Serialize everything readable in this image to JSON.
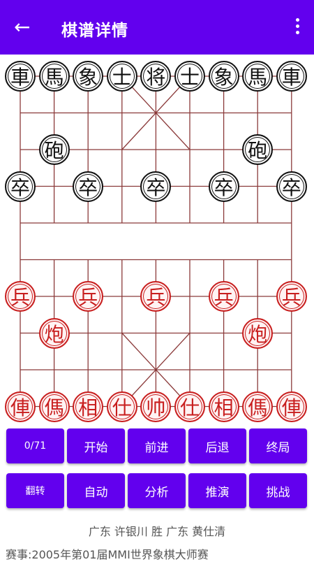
{
  "header": {
    "back_icon": "arrow-left-icon",
    "title": "棋谱详情",
    "more_icon": "more-vert-icon"
  },
  "colors": {
    "primary": "#6200ee",
    "board_line": "#8b3a3a",
    "red_piece": "#c81e1e",
    "black_piece": "#111111"
  },
  "board": {
    "black_pieces": [
      {
        "char": "車",
        "file": 0,
        "rank": 0
      },
      {
        "char": "馬",
        "file": 1,
        "rank": 0
      },
      {
        "char": "象",
        "file": 2,
        "rank": 0
      },
      {
        "char": "士",
        "file": 3,
        "rank": 0
      },
      {
        "char": "将",
        "file": 4,
        "rank": 0
      },
      {
        "char": "士",
        "file": 5,
        "rank": 0
      },
      {
        "char": "象",
        "file": 6,
        "rank": 0
      },
      {
        "char": "馬",
        "file": 7,
        "rank": 0
      },
      {
        "char": "車",
        "file": 8,
        "rank": 0
      },
      {
        "char": "砲",
        "file": 1,
        "rank": 2
      },
      {
        "char": "砲",
        "file": 7,
        "rank": 2
      },
      {
        "char": "卒",
        "file": 0,
        "rank": 3
      },
      {
        "char": "卒",
        "file": 2,
        "rank": 3
      },
      {
        "char": "卒",
        "file": 4,
        "rank": 3
      },
      {
        "char": "卒",
        "file": 6,
        "rank": 3
      },
      {
        "char": "卒",
        "file": 8,
        "rank": 3
      }
    ],
    "red_pieces": [
      {
        "char": "兵",
        "file": 0,
        "rank": 6
      },
      {
        "char": "兵",
        "file": 2,
        "rank": 6
      },
      {
        "char": "兵",
        "file": 4,
        "rank": 6
      },
      {
        "char": "兵",
        "file": 6,
        "rank": 6
      },
      {
        "char": "兵",
        "file": 8,
        "rank": 6
      },
      {
        "char": "炮",
        "file": 1,
        "rank": 7
      },
      {
        "char": "炮",
        "file": 7,
        "rank": 7
      },
      {
        "char": "俥",
        "file": 0,
        "rank": 9
      },
      {
        "char": "傌",
        "file": 1,
        "rank": 9
      },
      {
        "char": "相",
        "file": 2,
        "rank": 9
      },
      {
        "char": "仕",
        "file": 3,
        "rank": 9
      },
      {
        "char": "帅",
        "file": 4,
        "rank": 9
      },
      {
        "char": "仕",
        "file": 5,
        "rank": 9
      },
      {
        "char": "相",
        "file": 6,
        "rank": 9
      },
      {
        "char": "傌",
        "file": 7,
        "rank": 9
      },
      {
        "char": "俥",
        "file": 8,
        "rank": 9
      }
    ]
  },
  "controls": {
    "row1": [
      "0/71",
      "开始",
      "前进",
      "后退",
      "终局"
    ],
    "row2": [
      "翻转",
      "自动",
      "分析",
      "推演",
      "挑战"
    ]
  },
  "game_info": {
    "players": "广东 许银川 胜 广东 黄仕清",
    "event": "赛事:2005年第01届MMI世界象棋大师赛"
  }
}
